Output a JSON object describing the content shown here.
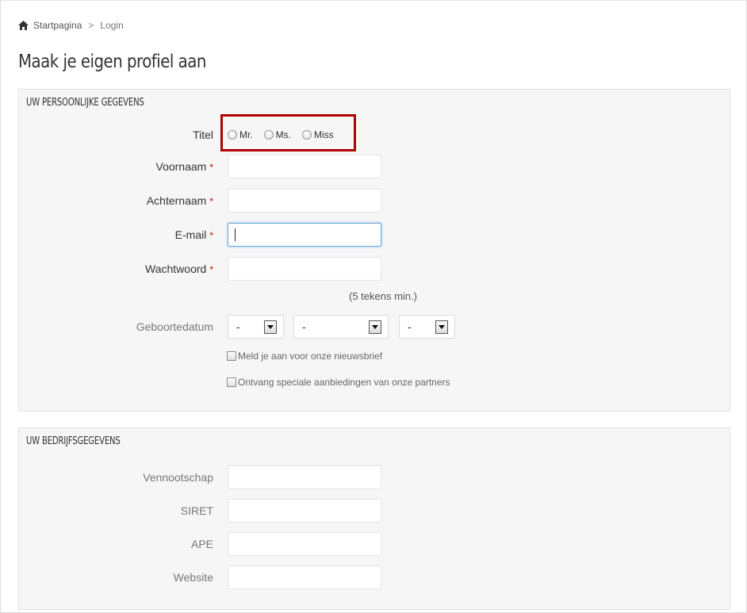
{
  "breadcrumb": {
    "home_label": "Startpagina",
    "separator": ">",
    "current": "Login"
  },
  "page_title": "Maak je eigen profiel aan",
  "personal": {
    "heading": "UW PERSOONLIJKE GEGEVENS",
    "title_label": "Titel",
    "title_options": [
      "Mr.",
      "Ms.",
      "Miss"
    ],
    "first_name_label": "Voornaam",
    "last_name_label": "Achternaam",
    "email_label": "E-mail",
    "password_label": "Wachtwoord",
    "password_hint": "(5 tekens min.)",
    "birthdate_label": "Geboortedatum",
    "birthdate_day": "-",
    "birthdate_month": "-",
    "birthdate_year": "-",
    "required_marker": "*",
    "newsletter_label": "Meld je aan voor onze nieuwsbrief",
    "partners_label": "Ontvang speciale aanbiedingen van onze partners"
  },
  "company": {
    "heading": "UW BEDRIJFSGEGEVENS",
    "company_label": "Vennootschap",
    "siret_label": "SIRET",
    "ape_label": "APE",
    "website_label": "Website"
  },
  "colors": {
    "highlight": "#b00000",
    "required": "#cc0000",
    "focus": "#6fa8dc",
    "panel_bg": "#f6f6f6"
  }
}
